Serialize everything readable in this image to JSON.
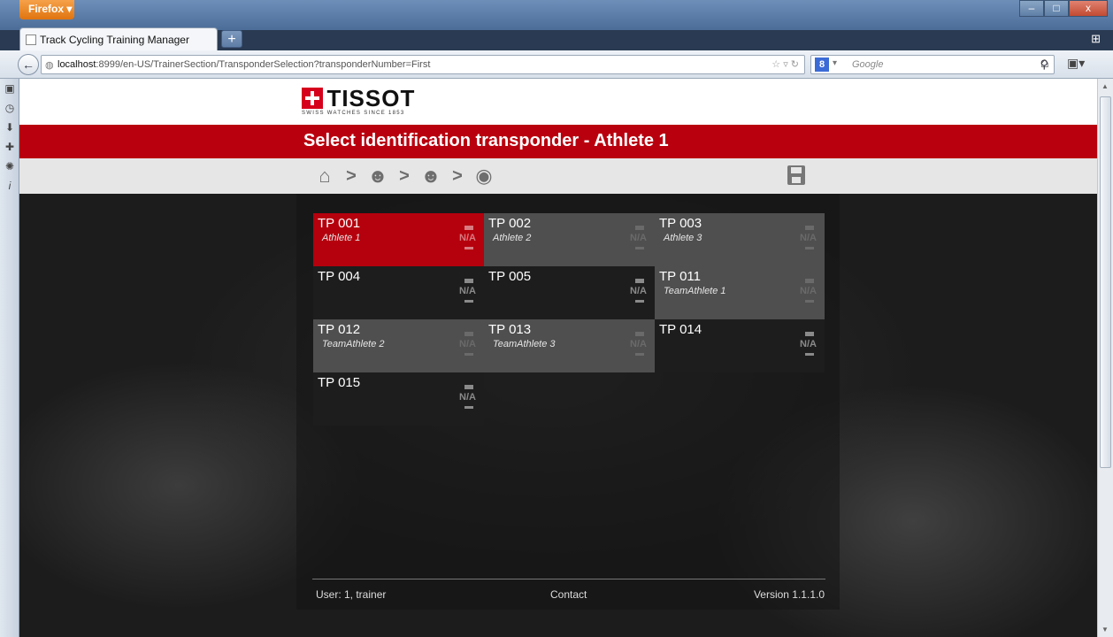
{
  "browser": {
    "menu_label": "Firefox ▾",
    "window_controls": [
      "–",
      "□",
      "x"
    ],
    "tab_title": "Track Cycling Training Manager",
    "new_tab_label": "+",
    "url_host": "localhost",
    "url_rest": ":8999/en-US/TrainerSection/TransponderSelection?transponderNumber=First",
    "search_placeholder": "Google",
    "search_engine_letter": "8",
    "icons": [
      "back-arrow-icon",
      "globe-icon",
      "star-icon",
      "reload-icon",
      "search-icon",
      "home-icon",
      "bookmarks-icon"
    ]
  },
  "sidebar": {
    "items": [
      "star-icon",
      "clock-icon",
      "download-icon",
      "addons-icon",
      "gear-icon",
      "info-icon"
    ]
  },
  "page": {
    "brand": "TISSOT",
    "tagline": "SWISS WATCHES SINCE 1853",
    "title": "Select identification transponder - Athlete 1",
    "breadcrumb": {
      "icons": [
        "home-icon",
        "athlete-icon",
        "athlete-icon",
        "transponder-icon"
      ],
      "separator": ">"
    },
    "transponders": [
      {
        "tp": "TP 001",
        "athlete": "Athlete 1",
        "style": "red"
      },
      {
        "tp": "TP 002",
        "athlete": "Athlete 2",
        "style": "gray"
      },
      {
        "tp": "TP 003",
        "athlete": "Athlete 3",
        "style": "gray"
      },
      {
        "tp": "TP 004",
        "athlete": "",
        "style": "dark"
      },
      {
        "tp": "TP 005",
        "athlete": "",
        "style": "dark"
      },
      {
        "tp": "TP 011",
        "athlete": "TeamAthlete 1",
        "style": "gray"
      },
      {
        "tp": "TP 012",
        "athlete": "TeamAthlete 2",
        "style": "gray"
      },
      {
        "tp": "TP 013",
        "athlete": "TeamAthlete 3",
        "style": "gray"
      },
      {
        "tp": "TP 014",
        "athlete": "",
        "style": "dark"
      },
      {
        "tp": "TP 015",
        "athlete": "",
        "style": "dark"
      }
    ],
    "na_label": "N/A",
    "footer": {
      "user": "User: 1, trainer",
      "contact": "Contact",
      "version": "Version 1.1.1.0"
    }
  }
}
